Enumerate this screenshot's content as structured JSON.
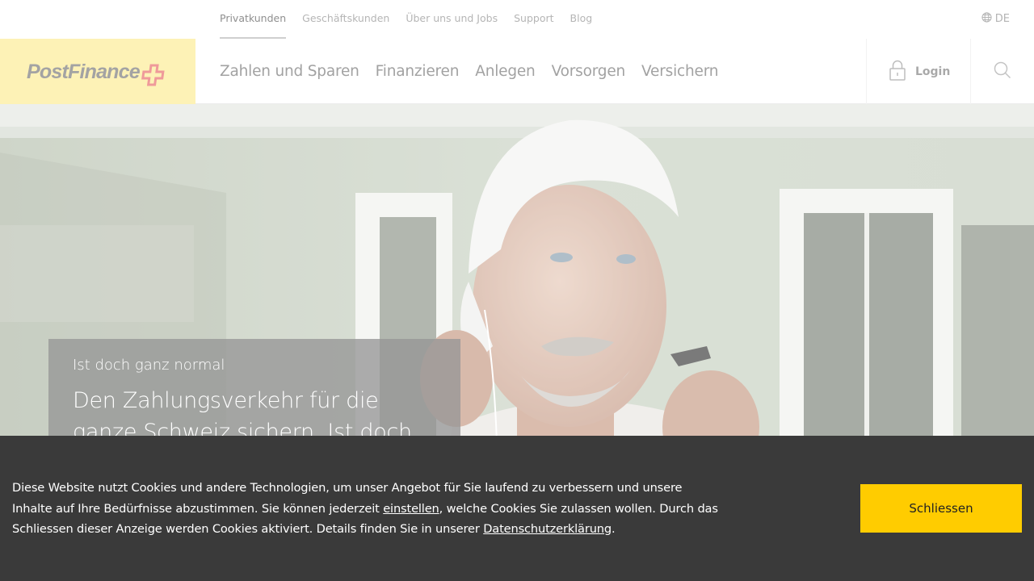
{
  "meta_nav": {
    "links": [
      {
        "label": "Privatkunden",
        "active": true
      },
      {
        "label": "Geschäftskunden",
        "active": false
      },
      {
        "label": "Über uns und Jobs",
        "active": false
      },
      {
        "label": "Support",
        "active": false
      },
      {
        "label": "Blog",
        "active": false
      }
    ],
    "language": {
      "icon": "globe-icon",
      "label": "DE"
    }
  },
  "header": {
    "logo": {
      "text": "PostFinance",
      "icon": "swiss-cross-logo"
    },
    "nav": [
      {
        "label": "Zahlen und Sparen"
      },
      {
        "label": "Finanzieren"
      },
      {
        "label": "Anlegen"
      },
      {
        "label": "Vorsorgen"
      },
      {
        "label": "Versichern"
      }
    ],
    "login": {
      "icon": "lock-icon",
      "label": "Login"
    },
    "search": {
      "icon": "search-icon"
    }
  },
  "hero": {
    "kicker": "Ist doch ganz normal",
    "title": "Den Zahlungsverkehr für die ganze Schweiz sichern. Ist doch ganz normal."
  },
  "cookie_banner": {
    "text_1": "Diese Website nutzt Cookies und andere Technologien, um unser Angebot für Sie laufend zu verbessern und unsere Inhalte auf Ihre Bedürfnisse abzustimmen. Sie können jederzeit ",
    "link_settings": "einstellen",
    "text_2": ", welche Cookies Sie zulassen wollen. Durch das Schliessen dieser Anzeige werden Cookies aktiviert. Details finden Sie in unserer ",
    "link_privacy": "Datenschutzerklärung",
    "text_3": ".",
    "close_button": "Schliessen"
  },
  "colors": {
    "brand_yellow": "#ffcc00",
    "logo_background": "#fdf2b6",
    "cookie_background": "#3a3a3a"
  }
}
